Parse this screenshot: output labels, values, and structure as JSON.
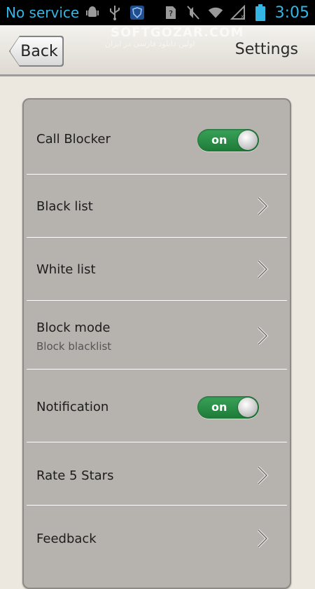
{
  "status_bar": {
    "carrier": "No service",
    "time": "3:05",
    "icons": [
      "android-icon",
      "usb-icon",
      "shield-icon",
      "question-sim-icon",
      "mute-icon",
      "wifi-icon",
      "no-signal-icon",
      "battery-icon"
    ]
  },
  "watermark": {
    "brand": "SOFTGOZAR.COM",
    "tagline": "اولین دانلود فارسی در ایران"
  },
  "header": {
    "back_label": "Back",
    "title": "Settings"
  },
  "settings": {
    "items": [
      {
        "label": "Call Blocker",
        "type": "toggle",
        "state": "on"
      },
      {
        "label": "Black list",
        "type": "link"
      },
      {
        "label": "White list",
        "type": "link"
      },
      {
        "label": "Block mode",
        "type": "link",
        "subtitle": "Block blacklist"
      },
      {
        "label": "Notification",
        "type": "toggle",
        "state": "on"
      },
      {
        "label": "Rate 5 Stars",
        "type": "link"
      },
      {
        "label": "Feedback",
        "type": "link"
      }
    ]
  },
  "colors": {
    "status_text": "#33b5e5",
    "toggle_on": "#2a8f46",
    "panel": "#b6b2ad"
  }
}
